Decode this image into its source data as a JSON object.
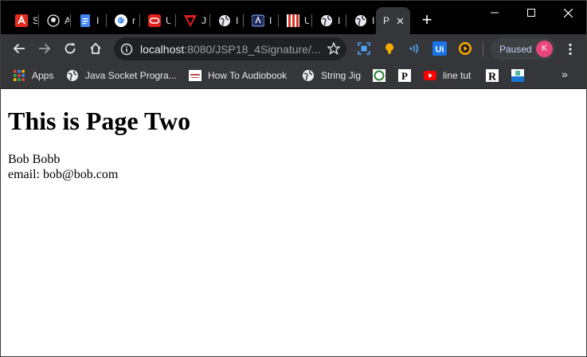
{
  "browser": {
    "tabs": [
      {
        "favicon": "acrobat-icon",
        "label": "S"
      },
      {
        "favicon": "github-icon",
        "label": "A"
      },
      {
        "favicon": "google-docs-icon",
        "label": "I"
      },
      {
        "favicon": "google-icon",
        "label": "r"
      },
      {
        "favicon": "oracle-icon",
        "label": "U"
      },
      {
        "favicon": "v-logo-icon",
        "label": "J"
      },
      {
        "favicon": "globe-icon",
        "label": "I"
      },
      {
        "favicon": "a-badge-icon",
        "label": "I"
      },
      {
        "favicon": "striped-icon",
        "label": "U"
      },
      {
        "favicon": "globe-icon",
        "label": "I"
      },
      {
        "favicon": "globe-icon",
        "label": "I"
      },
      {
        "favicon": "",
        "label": "P",
        "active": true
      }
    ],
    "new_tab_label": "+",
    "address": {
      "host": "localhost",
      "path": ":8080/JSP18_4Signature/..."
    },
    "profile": {
      "status": "Paused",
      "initial": "K"
    },
    "bookmarks": [
      {
        "icon": "apps-grid-icon",
        "label": "Apps"
      },
      {
        "icon": "globe-icon",
        "label": "Java Socket Progra..."
      },
      {
        "icon": "audiobook-icon",
        "label": "How To Audiobook"
      },
      {
        "icon": "globe-icon",
        "label": "String Jig"
      },
      {
        "icon": "circle-logo-icon",
        "label": ""
      },
      {
        "icon": "p-logo-icon",
        "label": ""
      },
      {
        "icon": "youtube-icon",
        "label": "line tut"
      },
      {
        "icon": "r-logo-icon",
        "label": ""
      },
      {
        "icon": "square-logo-icon",
        "label": ""
      }
    ],
    "bookmarks_more": "»",
    "colors": {
      "frame": "#000000",
      "toolbar": "#35363a",
      "omnibox": "#202124",
      "avatar": "#e8457a"
    }
  },
  "page": {
    "heading": "This is Page Two",
    "name_line": "Bob Bobb",
    "email_line": "email: bob@bob.com"
  }
}
